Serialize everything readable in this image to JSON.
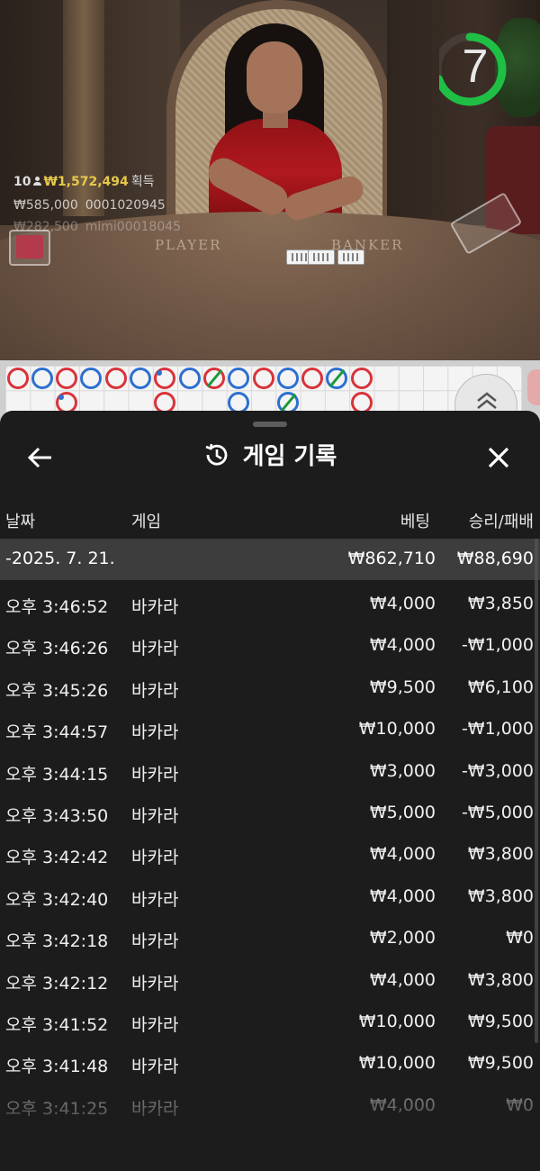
{
  "video": {
    "table_labels": [
      "PLAYER",
      "BANKER"
    ],
    "win": {
      "count": "10",
      "amount": "₩1,572,494",
      "suffix": "획득"
    },
    "bets": [
      {
        "amount": "₩585,000",
        "user": "0001020945"
      },
      {
        "amount": "₩282,500",
        "user": "mimi00018045"
      }
    ],
    "timer": {
      "value": "7",
      "progress": 0.7,
      "color": "#1fbf45"
    }
  },
  "road": {
    "row1": [
      "red",
      "blue",
      "red",
      "blue",
      "red",
      "blue",
      "red-pp",
      "blue",
      "red-tie",
      "blue",
      "red",
      "blue",
      "red",
      "blue-tie",
      "red"
    ],
    "row2": [
      "",
      "",
      "red-pp",
      "",
      "",
      "",
      "red",
      "",
      "",
      "blue",
      "",
      "blue-tie",
      "",
      "",
      "red"
    ],
    "colors": {
      "banker": "#d8333a",
      "player": "#2d6fd0",
      "tie": "#1c9a3a"
    }
  },
  "history": {
    "title": "게임 기록",
    "columns": {
      "date": "날짜",
      "game": "게임",
      "bet": "베팅",
      "win": "승리/패배"
    },
    "summary": {
      "date": "-2025. 7. 21.",
      "bet": "₩862,710",
      "win": "₩88,690"
    },
    "rows": [
      {
        "time": "오후 3:46:52",
        "game": "바카라",
        "bet": "₩4,000",
        "win": "₩3,850"
      },
      {
        "time": "오후 3:46:26",
        "game": "바카라",
        "bet": "₩4,000",
        "win": "-₩1,000"
      },
      {
        "time": "오후 3:45:26",
        "game": "바카라",
        "bet": "₩9,500",
        "win": "₩6,100"
      },
      {
        "time": "오후 3:44:57",
        "game": "바카라",
        "bet": "₩10,000",
        "win": "-₩1,000"
      },
      {
        "time": "오후 3:44:15",
        "game": "바카라",
        "bet": "₩3,000",
        "win": "-₩3,000"
      },
      {
        "time": "오후 3:43:50",
        "game": "바카라",
        "bet": "₩5,000",
        "win": "-₩5,000"
      },
      {
        "time": "오후 3:42:42",
        "game": "바카라",
        "bet": "₩4,000",
        "win": "₩3,800"
      },
      {
        "time": "오후 3:42:40",
        "game": "바카라",
        "bet": "₩4,000",
        "win": "₩3,800"
      },
      {
        "time": "오후 3:42:18",
        "game": "바카라",
        "bet": "₩2,000",
        "win": "₩0"
      },
      {
        "time": "오후 3:42:12",
        "game": "바카라",
        "bet": "₩4,000",
        "win": "₩3,800"
      },
      {
        "time": "오후 3:41:52",
        "game": "바카라",
        "bet": "₩10,000",
        "win": "₩9,500"
      },
      {
        "time": "오후 3:41:48",
        "game": "바카라",
        "bet": "₩10,000",
        "win": "₩9,500"
      },
      {
        "time": "오후 3:41:25",
        "game": "바카라",
        "bet": "₩4,000",
        "win": "₩0"
      }
    ]
  }
}
